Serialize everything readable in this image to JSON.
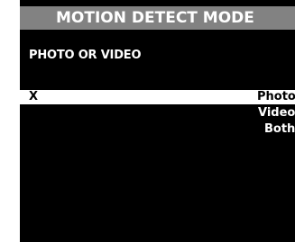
{
  "screen": {
    "title": "MOTION DETECT MODE",
    "prompt": "PHOTO OR VIDEO",
    "selected_marker": "X",
    "options": [
      {
        "label": "Photo",
        "selected": true
      },
      {
        "label": "Video",
        "selected": false
      },
      {
        "label": "Both",
        "selected": false
      }
    ]
  },
  "colors": {
    "background": "#000000",
    "title_bar": "#828282",
    "selected_row": "#ffffff",
    "text": "#ffffff"
  }
}
